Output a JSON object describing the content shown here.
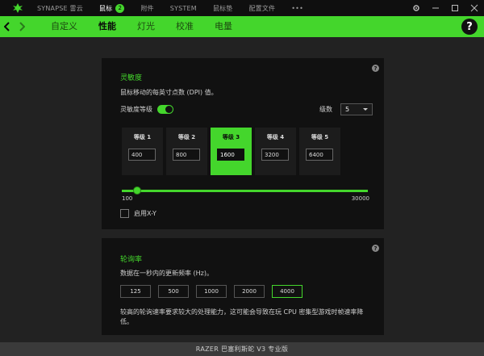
{
  "titlebar": {
    "nav": [
      {
        "label": "SYNAPSE 雷云",
        "active": false
      },
      {
        "label": "鼠标",
        "active": true,
        "badge": "2"
      },
      {
        "label": "附件",
        "active": false
      },
      {
        "label": "SYSTEM",
        "active": false
      },
      {
        "label": "鼠标垫",
        "active": false
      },
      {
        "label": "配置文件",
        "active": false
      },
      {
        "label": "•••",
        "active": false
      }
    ],
    "icons": [
      "razer-logo",
      "gear-icon",
      "minimize-icon",
      "maximize-icon",
      "close-icon"
    ]
  },
  "subnav": {
    "tabs": [
      {
        "label": "自定义",
        "active": false
      },
      {
        "label": "性能",
        "active": true
      },
      {
        "label": "灯光",
        "active": false
      },
      {
        "label": "校准",
        "active": false
      },
      {
        "label": "电量",
        "active": false
      }
    ],
    "help": "?"
  },
  "sensitivity": {
    "title": "灵敏度",
    "desc": "鼠标移动的每英寸点数 (DPI) 值。",
    "toggle_label": "灵敏度等级",
    "toggle_on": true,
    "levels_label": "级数",
    "levels_value": "5",
    "stages": [
      {
        "label": "等级 1",
        "value": "400",
        "active": false
      },
      {
        "label": "等级 2",
        "value": "800",
        "active": false
      },
      {
        "label": "等级 3",
        "value": "1600",
        "active": true
      },
      {
        "label": "等级 4",
        "value": "3200",
        "active": false
      },
      {
        "label": "等级 5",
        "value": "6400",
        "active": false
      }
    ],
    "slider_min": "100",
    "slider_max": "30000",
    "slider_value": 1600,
    "xy_label": "启用X-Y"
  },
  "polling": {
    "title": "轮询率",
    "desc": "数据在一秒内的更新频率 (Hz)。",
    "rates": [
      {
        "label": "125",
        "active": false
      },
      {
        "label": "500",
        "active": false
      },
      {
        "label": "1000",
        "active": false
      },
      {
        "label": "2000",
        "active": false
      },
      {
        "label": "4000",
        "active": true
      }
    ],
    "note": "较高的轮询速率要求较大的处理能力，这可能会导致在玩 CPU 密集型游戏时帧速率降低。"
  },
  "footer": {
    "device": "RAZER 巴塞利斯蛇 V3 专业版"
  },
  "colors": {
    "accent": "#44d62c",
    "panel": "#111111",
    "background": "#222222"
  }
}
